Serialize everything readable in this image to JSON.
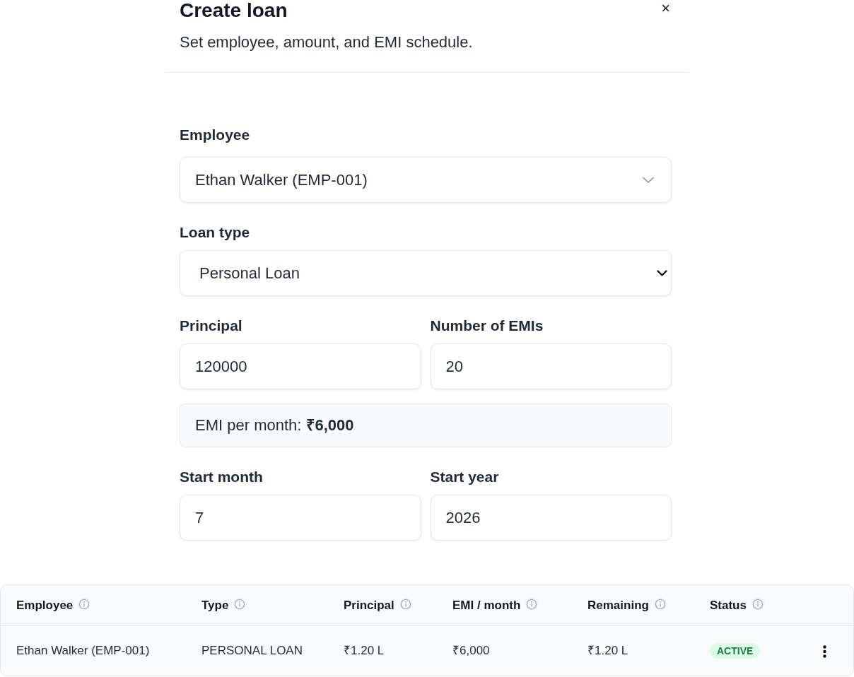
{
  "dialog": {
    "title": "Create loan",
    "subtitle": "Set employee, amount, and EMI schedule.",
    "close": "×"
  },
  "form": {
    "rows": [
      {
        "items": [
          {
            "kind": "combobox",
            "label": "Employee",
            "value": "Ethan Walker (EMP-001)"
          }
        ]
      },
      {
        "items": [
          {
            "kind": "select",
            "label": "Loan type",
            "value": "Personal Loan"
          }
        ]
      },
      {
        "items": [
          {
            "kind": "input",
            "label": "Principal",
            "value": "120000"
          },
          {
            "kind": "input",
            "label": "Number of EMIs",
            "value": "20"
          }
        ]
      },
      {
        "items": [
          {
            "kind": "note",
            "text": "EMI per month: **₹6,000**"
          }
        ]
      },
      {
        "items": [
          {
            "kind": "input",
            "label": "Start month",
            "value": "7"
          },
          {
            "kind": "input",
            "label": "Start year",
            "value": "2026"
          }
        ]
      }
    ]
  },
  "table": {
    "columns": [
      "Employee",
      "Type",
      "Principal",
      "EMI / month",
      "Remaining",
      "Status"
    ],
    "rows": [
      {
        "cells": [
          "Ethan Walker (EMP-001)",
          "PERSONAL LOAN",
          "₹1.20 L",
          "₹6,000",
          "₹1.20 L"
        ],
        "status": "ACTIVE"
      }
    ]
  }
}
